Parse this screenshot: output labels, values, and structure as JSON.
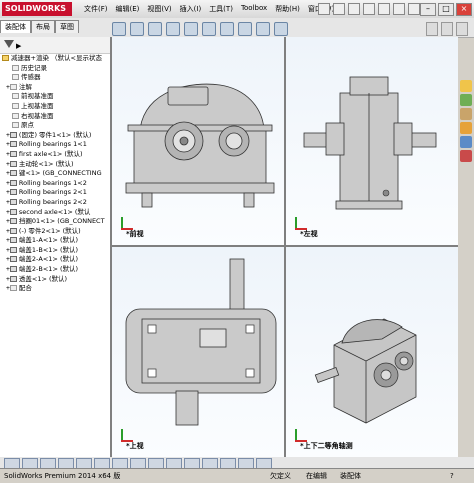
{
  "app": {
    "logo": "SOLIDWORKS"
  },
  "menu": [
    "文件(F)",
    "编辑(E)",
    "视图(V)",
    "插入(I)",
    "工具(T)",
    "Toolbox",
    "帮助(H)",
    "窗口(W)"
  ],
  "feature_manager": {
    "tabs": [
      "装配体",
      "布局",
      "草图"
    ],
    "rows": [
      "减速器+渲染 （默认<显示状态",
      "历史记录",
      "传感器",
      "注解",
      "前视基准面",
      "上视基准面",
      "右视基准面",
      "原点",
      "(固定) 零件1<1> (默认)",
      "Rolling bearings 1<1",
      "first axle<1> (默认)",
      "主动轮<1> (默认)",
      "键<1> (GB_CONNECTING",
      "Rolling bearings 1<2",
      "Rolling bearings 2<1",
      "Rolling bearings 2<2",
      "second axle<1> (默认",
      "挡圈01<1> (GB_CONNECT",
      "(-) 零件2<1> (默认)",
      "端盖1-A<1> (默认)",
      "端盖1-B<1> (默认)",
      "端盖2-A<1> (默认)",
      "端盖2-B<1> (默认)",
      "透盖<1> (默认)",
      "配合"
    ]
  },
  "viewports": {
    "front": "*前视",
    "left": "*左视",
    "top": "*上视",
    "iso": "*上下二等角轴测"
  },
  "status": {
    "version": "SolidWorks Premium 2014 x64 版",
    "defined": "欠定义",
    "editing": "在编辑",
    "mode": "装配体",
    "icon": "?"
  },
  "colors": {
    "viewport_bg": "#f4f8fc",
    "part": "#c9c9c9",
    "outline": "#333333",
    "brand": "#c8102e"
  }
}
